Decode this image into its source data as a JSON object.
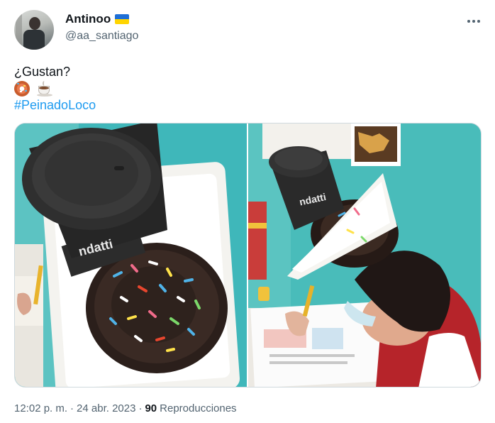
{
  "author": {
    "display_name": "Antinoo",
    "handle": "@aa_santiago",
    "flag_icon": "ukraine-flag-icon",
    "more_icon": "more-options-icon"
  },
  "tweet": {
    "text": "¿Gustan?",
    "emojis": [
      "donut-icon",
      "coffee-icon"
    ],
    "hashtag": "#PeinadoLoco",
    "link_color": "#1d9bf0"
  },
  "media": {
    "photo_count": 2,
    "left_photo_label": "ndatti",
    "right_photo_label": "ndatti"
  },
  "meta": {
    "time": "12:02 p. m.",
    "separator_1": "·",
    "date": "24 abr. 2023",
    "separator_2": "·",
    "views_count": "90",
    "views_label": "Reproducciones"
  }
}
